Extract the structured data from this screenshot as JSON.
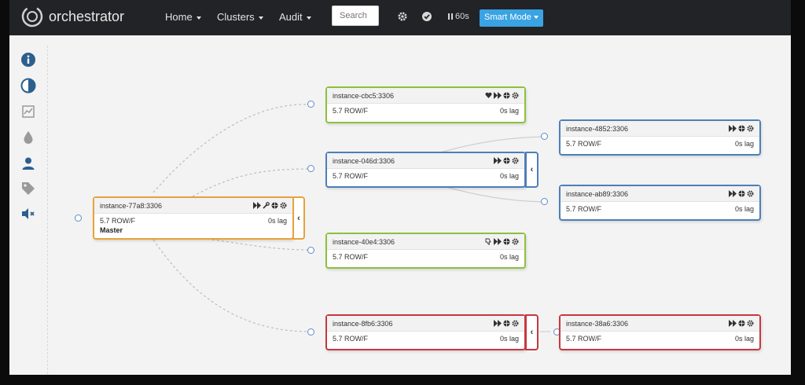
{
  "app": {
    "name": "orchestrator"
  },
  "nav": {
    "home": "Home",
    "clusters": "Clusters",
    "audit": "Audit",
    "search_placeholder": "Search",
    "poll_interval": "60s",
    "smart_mode": "Smart Mode"
  },
  "sidebar": {
    "icons": [
      "info-icon",
      "contrast-icon",
      "chart-icon",
      "drop-icon",
      "user-icon",
      "tag-icon",
      "mute-icon"
    ]
  },
  "colors": {
    "green": "#8cc13b",
    "blue": "#4d7fb8",
    "orange": "#e8a23a",
    "red": "#c8373f",
    "accent": "#3aa3e3"
  },
  "instances": {
    "master": {
      "name": "instance-77a8:3306",
      "version": "5.7 ROW/F",
      "lag": "0s lag",
      "role": "Master"
    },
    "cbc5": {
      "name": "instance-cbc5:3306",
      "version": "5.7 ROW/F",
      "lag": "0s lag"
    },
    "i046d": {
      "name": "instance-046d:3306",
      "version": "5.7 ROW/F",
      "lag": "0s lag"
    },
    "i40e4": {
      "name": "instance-40e4:3306",
      "version": "5.7 ROW/F",
      "lag": "0s lag"
    },
    "i8fb6": {
      "name": "instance-8fb6:3306",
      "version": "5.7 ROW/F",
      "lag": "0s lag"
    },
    "i4852": {
      "name": "instance-4852:3306",
      "version": "5.7 ROW/F",
      "lag": "0s lag"
    },
    "ab89": {
      "name": "instance-ab89:3306",
      "version": "5.7 ROW/F",
      "lag": "0s lag"
    },
    "i38a6": {
      "name": "instance-38a6:3306",
      "version": "5.7 ROW/F",
      "lag": "0s lag"
    }
  }
}
